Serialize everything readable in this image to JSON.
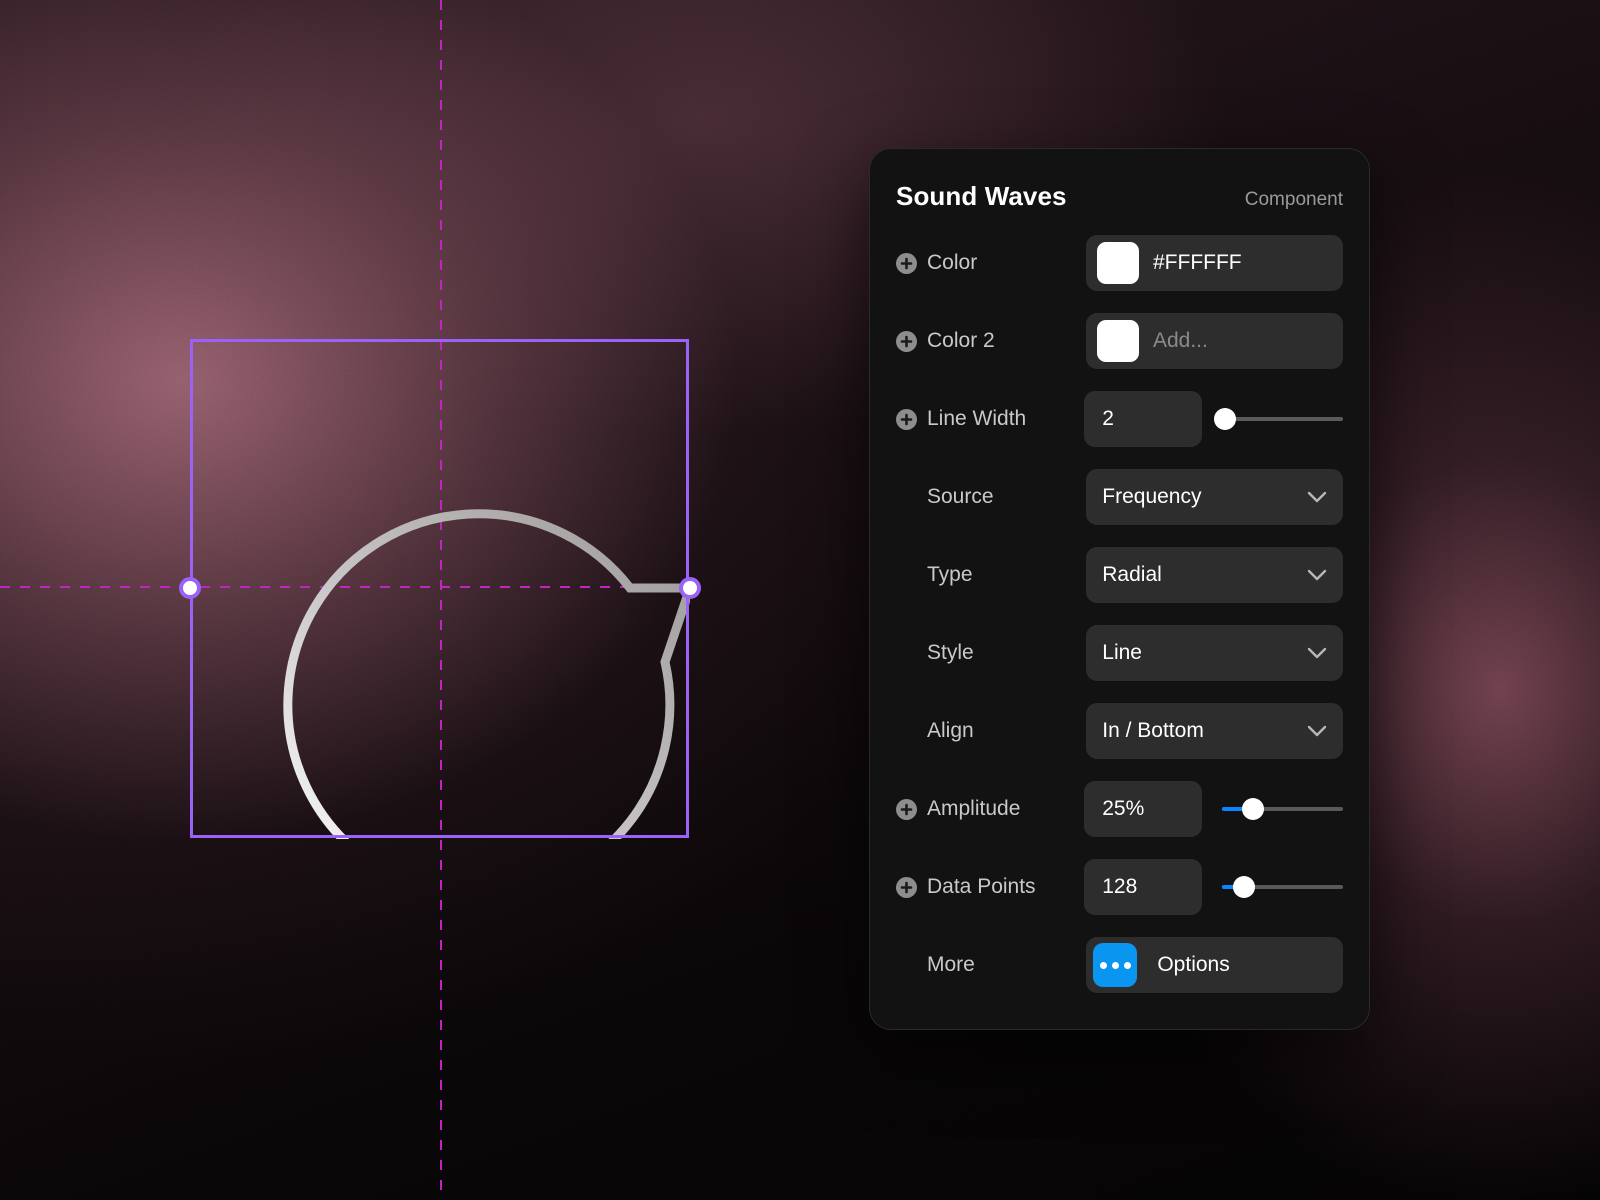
{
  "canvas": {
    "selection_label": "selection-bounding-box",
    "handles": [
      "left-middle-handle",
      "right-middle-handle"
    ],
    "guides": [
      "vertical-center-guide",
      "horizontal-center-guide"
    ],
    "waveform": "radial-sound-wave-preview"
  },
  "panel": {
    "title": "Sound Waves",
    "kind": "Component",
    "rows": [
      {
        "label": "Color",
        "has_add": true,
        "control": "color",
        "swatch": "#FFFFFF",
        "value": "#FFFFFF",
        "placeholder": ""
      },
      {
        "label": "Color 2",
        "has_add": true,
        "control": "color",
        "swatch": "#FFFFFF",
        "value": "",
        "placeholder": "Add..."
      },
      {
        "label": "Line Width",
        "has_add": true,
        "control": "number",
        "value": "2",
        "slider": 3,
        "fill": false
      },
      {
        "label": "Source",
        "has_add": false,
        "control": "select",
        "value": "Frequency"
      },
      {
        "label": "Type",
        "has_add": false,
        "control": "select",
        "value": "Radial"
      },
      {
        "label": "Style",
        "has_add": false,
        "control": "select",
        "value": "Line"
      },
      {
        "label": "Align",
        "has_add": false,
        "control": "select",
        "value": "In / Bottom"
      },
      {
        "label": "Amplitude",
        "has_add": true,
        "control": "number",
        "value": "25%",
        "slider": 26,
        "fill": true
      },
      {
        "label": "Data Points",
        "has_add": true,
        "control": "number",
        "value": "128",
        "slider": 18,
        "fill": true
      },
      {
        "label": "More",
        "has_add": false,
        "control": "options",
        "value": "Options"
      }
    ]
  },
  "colors": {
    "accent_blue": "#0A84FF",
    "options_blue": "#0A96F0",
    "selection_purple": "#9A62F7",
    "guide_magenta": "#BF25BF",
    "panel_bg": "#121212",
    "field_bg": "#2D2D2D"
  }
}
